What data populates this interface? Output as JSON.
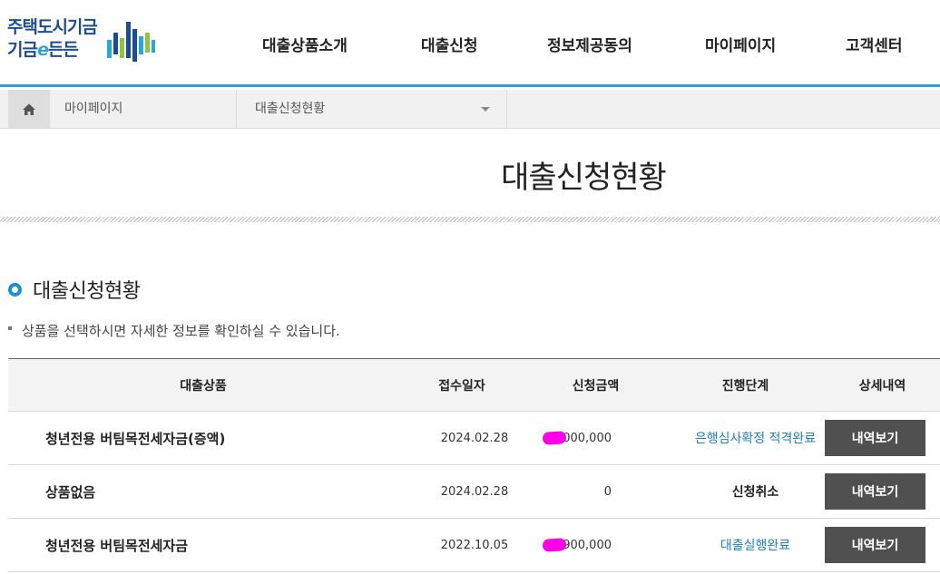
{
  "logo": {
    "line1": "주택도시기금",
    "line2_a": "기금",
    "line2_e": "e",
    "line2_b": "든든"
  },
  "nav": [
    {
      "label": "대출상품소개"
    },
    {
      "label": "대출신청"
    },
    {
      "label": "정보제공동의"
    },
    {
      "label": "마이페이지"
    },
    {
      "label": "고객센터"
    }
  ],
  "breadcrumb": {
    "level1": "마이페이지",
    "level2": "대출신청현황"
  },
  "page_title": "대출신청현황",
  "section": {
    "title": "대출신청현황",
    "note": "상품을 선택하시면 자세한 정보를 확인하실 수 있습니다."
  },
  "table": {
    "headers": [
      "대출상품",
      "접수일자",
      "신청금액",
      "진행단계",
      "상세내역"
    ],
    "rows": [
      {
        "product": "청년전용 버팀목전세자금(증액)",
        "date": "2024.02.28",
        "amount": "000,000",
        "status": "은행심사확정 적격완료",
        "status_color": "#1d7fbf",
        "button": "내역보기"
      },
      {
        "product": "상품없음",
        "date": "2024.02.28",
        "amount": "0",
        "status": "신청취소",
        "status_color": "#222222",
        "button": "내역보기"
      },
      {
        "product": "청년전용 버팀목전세자금",
        "date": "2022.10.05",
        "amount": "900,000",
        "status": "대출실행완료",
        "status_color": "#1d7fbf",
        "button": "내역보기"
      }
    ]
  },
  "colors": {
    "accent": "#2b9fd8",
    "button_bg": "#505050",
    "mask": "#ff00e6"
  }
}
